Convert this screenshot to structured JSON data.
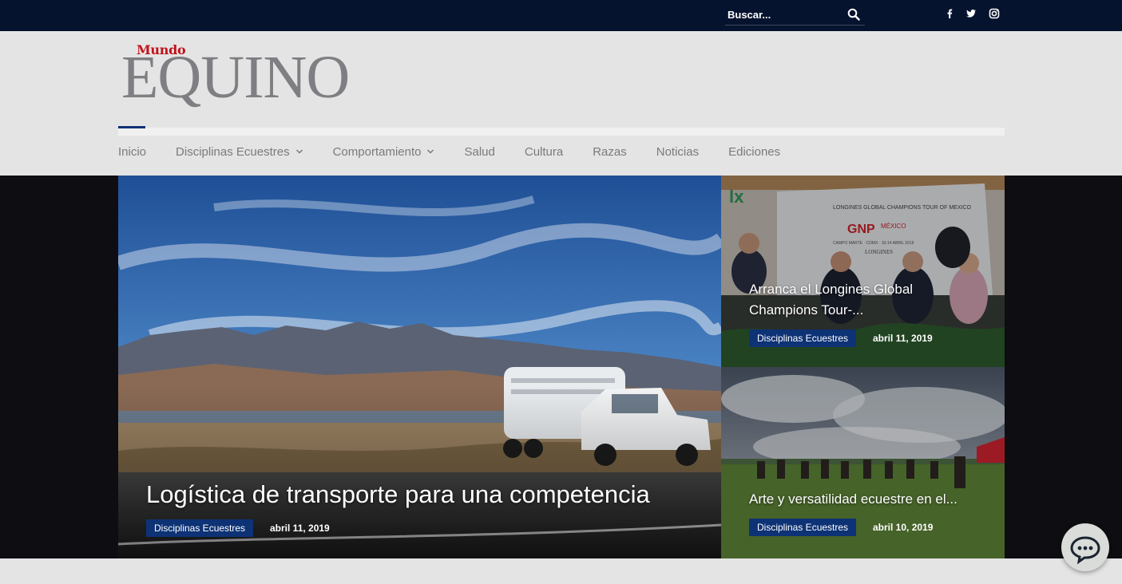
{
  "topbar": {
    "search": {
      "placeholder": "Buscar...",
      "icon": "search-icon"
    },
    "social": [
      {
        "name": "facebook",
        "icon": "facebook-icon"
      },
      {
        "name": "twitter",
        "icon": "twitter-icon"
      },
      {
        "name": "instagram",
        "icon": "instagram-icon"
      }
    ]
  },
  "logo": {
    "top": "Mundo",
    "main": "EQUINO"
  },
  "nav": {
    "items": [
      {
        "label": "Inicio",
        "dropdown": false
      },
      {
        "label": "Disciplinas Ecuestres",
        "dropdown": true
      },
      {
        "label": "Comportamiento",
        "dropdown": true
      },
      {
        "label": "Salud",
        "dropdown": false
      },
      {
        "label": "Cultura",
        "dropdown": false
      },
      {
        "label": "Razas",
        "dropdown": false
      },
      {
        "label": "Noticias",
        "dropdown": false
      },
      {
        "label": "Ediciones",
        "dropdown": false
      }
    ]
  },
  "featured": {
    "main": {
      "title": "Logística de transporte para una competencia",
      "category": "Disciplinas Ecuestres",
      "date": "abril 11, 2019"
    },
    "side_top": {
      "title_line1": "Arranca el Longines Global",
      "title_line2": "Champions Tour-...",
      "category": "Disciplinas Ecuestres",
      "date": "abril 11, 2019",
      "banner_text": {
        "tour": "LONGINES GLOBAL CHAMPIONS TOUR OF MEXICO",
        "sponsor": "GNP",
        "sponsor_sub": "MÉXICO",
        "venue": "CAMPO MARTE · CDMX · 10-14 ABRIL 2019",
        "brand": "LONGINES",
        "brand_partial": "lx"
      }
    },
    "side_bottom": {
      "title": "Arte y versatilidad ecuestre en el...",
      "category": "Disciplinas Ecuestres",
      "date": "abril 10, 2019"
    }
  },
  "chat": {
    "icon": "chat-bubble-icon"
  },
  "colors": {
    "topbar": "#06132f",
    "tag": "#0d3275",
    "logo_red": "#c2111a",
    "logo_gray": "#7f7f83"
  }
}
